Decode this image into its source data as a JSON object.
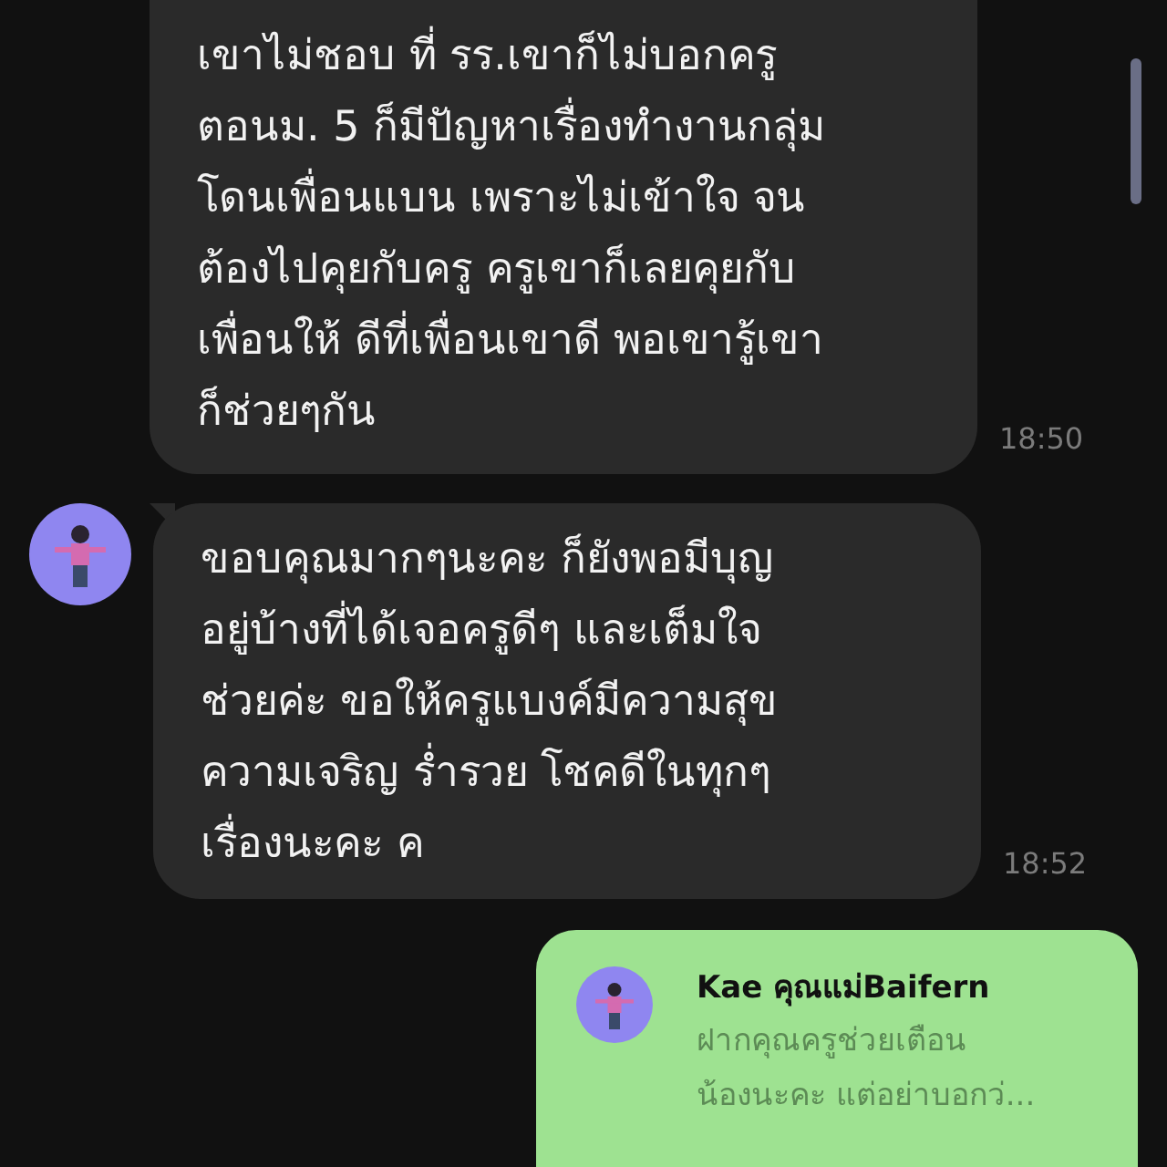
{
  "messages": [
    {
      "kind": "incoming",
      "avatar": false,
      "text": "เขาไม่ชอบ ที่ รร.เขาก็ไม่บอกครู\nตอนม. 5 ก็มีปัญหาเรื่องทำงานกลุ่ม\nโดนเพื่อนแบน เพราะไม่เข้าใจ จน\nต้องไปคุยกับครู ครูเขาก็เลยคุยกับ\nเพื่อนให้ ดีที่เพื่อนเขาดี พอเขารู้เขา\nก็ช่วยๆกัน",
      "time": "18:50"
    },
    {
      "kind": "incoming",
      "avatar": true,
      "text": "ขอบคุณมากๆนะคะ ก็ยังพอมีบุญ\nอยู่บ้างที่ได้เจอครูดีๆ และเต็มใจ\nช่วยค่ะ ขอให้ครูแบงค์มีความสุข\nความเจริญ ร่ำรวย โชคดีในทุกๆ\nเรื่องนะคะ ค",
      "time": "18:52"
    },
    {
      "kind": "reply",
      "sender": "Kae คุณแม่Baifern",
      "text": "ฝากคุณครูช่วยเตือน\nน้องนะคะ แต่อย่าบอกว่..."
    }
  ]
}
